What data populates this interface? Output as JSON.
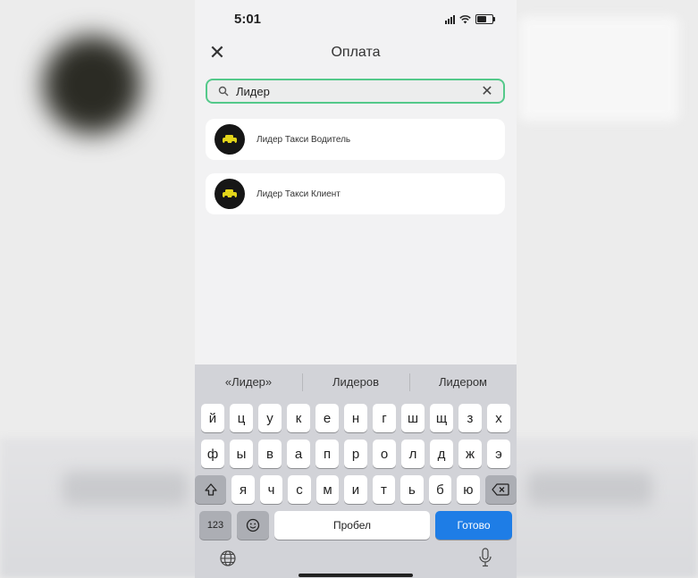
{
  "status_bar": {
    "time": "5:01"
  },
  "header": {
    "title": "Оплата",
    "close_icon": "✕"
  },
  "search": {
    "value": "Лидер",
    "placeholder": "",
    "clear_icon": "✕"
  },
  "results": [
    {
      "label": "Лидер Такси Водитель"
    },
    {
      "label": "Лидер Такси Клиент"
    }
  ],
  "keyboard": {
    "suggestions": [
      "«Лидер»",
      "Лидеров",
      "Лидером"
    ],
    "row1": [
      "й",
      "ц",
      "у",
      "к",
      "е",
      "н",
      "г",
      "ш",
      "щ",
      "з",
      "х"
    ],
    "row2": [
      "ф",
      "ы",
      "в",
      "а",
      "п",
      "р",
      "о",
      "л",
      "д",
      "ж",
      "э"
    ],
    "row3": [
      "я",
      "ч",
      "с",
      "м",
      "и",
      "т",
      "ь",
      "б",
      "ю"
    ],
    "numbers_label": "123",
    "space_label": "Пробел",
    "done_label": "Готово"
  },
  "colors": {
    "search_border": "#54c98a",
    "done_key": "#1e7de6",
    "logo_bg": "#161616",
    "logo_accent": "#e3d51a"
  }
}
